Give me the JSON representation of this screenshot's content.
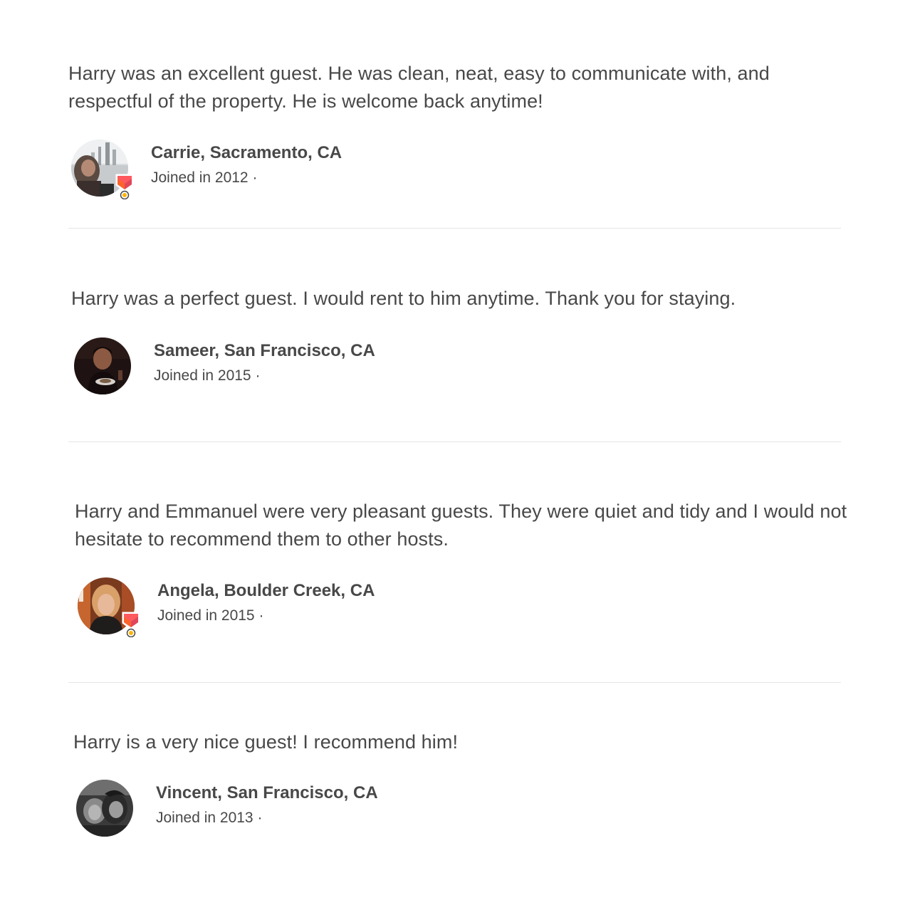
{
  "reviews": [
    {
      "text": "Harry was an excellent guest. He was clean, neat, easy to communicate with, and respectful of the property. He is welcome back anytime!",
      "reviewer_name": "Carrie, Sacramento, CA",
      "joined": "Joined in 2012 ·",
      "superhost": true
    },
    {
      "text": "Harry was a perfect guest. I would rent to him anytime. Thank you for staying.",
      "reviewer_name": "Sameer, San Francisco, CA",
      "joined": "Joined in 2015 ·",
      "superhost": false
    },
    {
      "text": "Harry and Emmanuel were very pleasant guests. They were quiet and tidy and I would not hesitate to recommend them to other hosts.",
      "reviewer_name": "Angela, Boulder Creek, CA",
      "joined": "Joined in 2015 ·",
      "superhost": true
    },
    {
      "text": "Harry is a very nice guest! I recommend him!",
      "reviewer_name": "Vincent, San Francisco, CA",
      "joined": "Joined in 2013 ·",
      "superhost": false
    }
  ],
  "colors": {
    "text": "#484848",
    "divider": "#e4e4e4",
    "badge_red": "#ff5a5f",
    "badge_orange": "#fc642d",
    "badge_yellow": "#ffb400"
  }
}
